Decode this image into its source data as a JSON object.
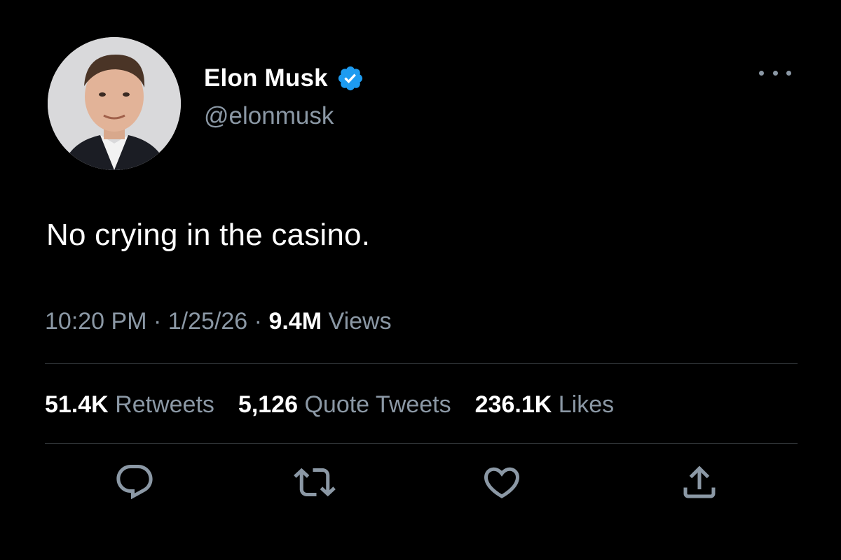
{
  "tweet": {
    "author": {
      "display_name": "Elon Musk",
      "handle": "@elonmusk",
      "avatar_icon": "profile-photo",
      "verified_icon": "verified-badge-icon",
      "verified_color": "#1d9bf0"
    },
    "text": "No crying in the casino.",
    "time": "10:20 PM",
    "date": "1/25/26",
    "views_count": "9.4M",
    "views_label": "Views",
    "separator": "·"
  },
  "stats": {
    "retweets_count": "51.4K",
    "retweets_label": "Retweets",
    "quotes_count": "5,126",
    "quotes_label": "Quote Tweets",
    "likes_count": "236.1K",
    "likes_label": "Likes"
  },
  "actions": [
    "reply-icon",
    "retweet-icon",
    "like-icon",
    "share-icon"
  ],
  "colors": {
    "background": "#000000",
    "text": "#ffffff",
    "secondary_text": "#8b98a5",
    "divider": "#2f3336",
    "accent": "#1d9bf0"
  }
}
